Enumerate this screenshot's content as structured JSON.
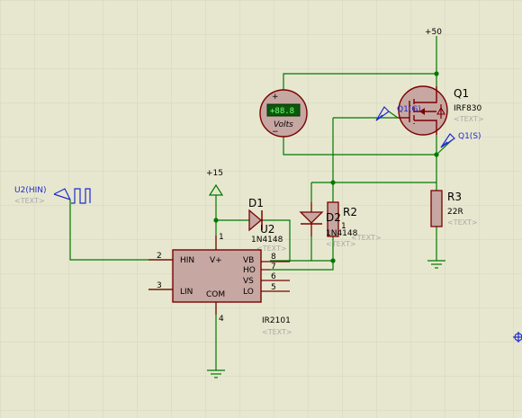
{
  "colors": {
    "background": "#e7e7cf",
    "grid": "#d6d6bc",
    "wire": "#007800",
    "body_outline": "#7a0000",
    "body_fill": "#c7a7a2",
    "pin": "#7a0000",
    "text": "#000000",
    "placeholder": "#a9a9a9",
    "probe": "#1e2bd0",
    "meter_screen": "#0b5a0b",
    "meter_digits": "#7dff7d"
  },
  "components": {
    "u2": {
      "ref": "U2",
      "part": "IR2101",
      "text": "<TEXT>",
      "pins": {
        "hin": "HIN",
        "lin": "LIN",
        "vplus": "V+",
        "com": "COM",
        "vb": "VB",
        "ho": "HO",
        "vs": "VS",
        "lo": "LO"
      },
      "pin_numbers": {
        "hin": "2",
        "lin": "3",
        "vplus": "1",
        "com": "4",
        "vb": "8",
        "ho": "7",
        "vs": "6",
        "lo": "5"
      }
    },
    "d1": {
      "ref": "D1",
      "part": "1N4148",
      "text": "<TEXT>"
    },
    "d2": {
      "ref": "D2",
      "part": "1N4148",
      "text": "<TEXT>"
    },
    "r2": {
      "ref": "R2",
      "value": "1",
      "text": "<TEXT>"
    },
    "r3": {
      "ref": "R3",
      "value": "22R",
      "text": "<TEXT>"
    },
    "q1": {
      "ref": "Q1",
      "part": "IRF830",
      "text": "<TEXT>"
    },
    "voltmeter": {
      "display": "+88.8",
      "unit": "Volts"
    },
    "gen": {
      "ref": "U2(HIN)",
      "text": "<TEXT>"
    }
  },
  "power": {
    "v50": "+50",
    "v15": "+15"
  },
  "probes": {
    "gate": "Q1(G)",
    "source": "Q1(S)"
  }
}
